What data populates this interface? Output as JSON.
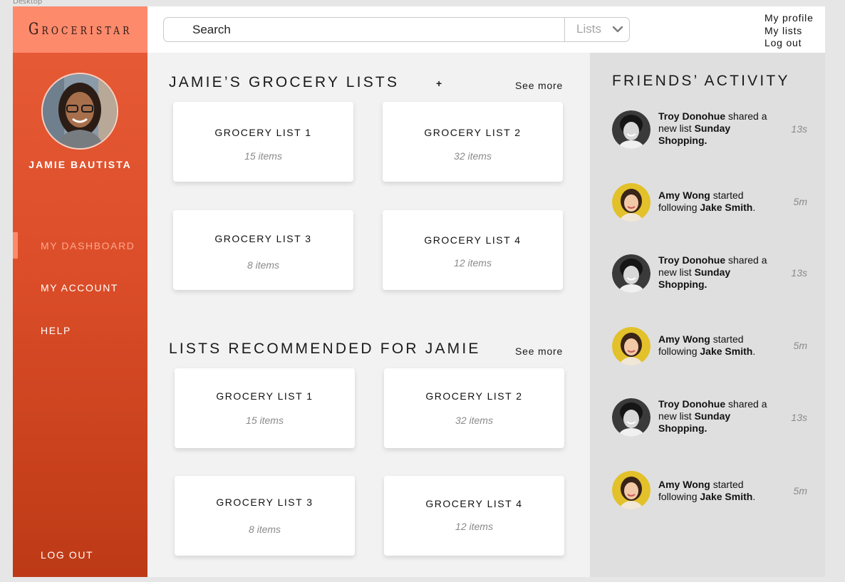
{
  "frame_label": "Desktop",
  "app": {
    "logo": "Groceristar",
    "search": {
      "value": "Search",
      "select_value": "Lists"
    },
    "top_links": [
      "My profile",
      "My lists",
      "Log out"
    ]
  },
  "sidebar": {
    "user_name": "JAMIE BAUTISTA",
    "nav": [
      "MY DASHBOARD",
      "MY ACCOUNT",
      "HELP"
    ],
    "logout": "LOG OUT"
  },
  "my_lists": {
    "title": "JAMIE’S GROCERY LISTS",
    "add_label": "+",
    "see_more": "See more",
    "cards": [
      {
        "title": "GROCERY LIST 1",
        "count": "15 items"
      },
      {
        "title": "GROCERY LIST 2",
        "count": "32 items"
      },
      {
        "title": "GROCERY LIST 3",
        "count": "8 items"
      },
      {
        "title": "GROCERY LIST 4",
        "count": "12 items"
      }
    ]
  },
  "recommended": {
    "title": "LISTS RECOMMENDED FOR JAMIE",
    "see_more": "See more",
    "cards": [
      {
        "title": "GROCERY LIST 1",
        "count": "15 items"
      },
      {
        "title": "GROCERY LIST 2",
        "count": "32 items"
      },
      {
        "title": "GROCERY LIST 3",
        "count": "8 items"
      },
      {
        "title": "GROCERY LIST 4",
        "count": "12 items"
      }
    ]
  },
  "friends": {
    "title": "FRIENDS’ ACTIVITY",
    "items": [
      {
        "name": "Troy Donohue",
        "verb": " shared a new list ",
        "object": "Sunday Shopping.",
        "tail": "",
        "time": "13s"
      },
      {
        "name": "Amy Wong",
        "verb": " started following ",
        "object": "Jake Smith",
        "tail": ".",
        "time": "5m"
      },
      {
        "name": "Troy Donohue",
        "verb": " shared a new list ",
        "object": "Sunday Shopping.",
        "tail": "",
        "time": "13s"
      },
      {
        "name": "Amy Wong",
        "verb": " started following ",
        "object": "Jake Smith",
        "tail": ".",
        "time": "5m"
      },
      {
        "name": "Troy Donohue",
        "verb": " shared a new list ",
        "object": "Sunday Shopping.",
        "tail": "",
        "time": "13s"
      },
      {
        "name": "Amy Wong",
        "verb": " started following ",
        "object": "Jake Smith",
        "tail": ".",
        "time": "5m"
      }
    ]
  },
  "colors": {
    "sidebar_top": "#e85c38",
    "sidebar_bottom": "#bd3a16",
    "logo_bg": "#fe8a6c",
    "active_nav": "#ffa68d",
    "friends_bg": "#dfdfdf"
  }
}
